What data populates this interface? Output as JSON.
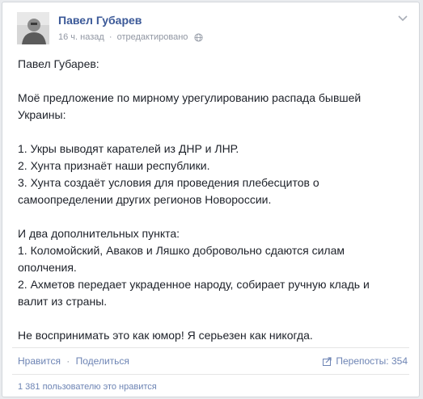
{
  "post": {
    "author": "Павел Губарев",
    "time": "16 ч. назад",
    "edited": "отредактировано",
    "body_lines": [
      "Павел Губарев:",
      "",
      "Моё предложение по мирному урегулированию распада бывшей",
      "Украины:",
      "",
      "1. Укры выводят карателей из ДНР и ЛНР.",
      "2. Хунта признаёт наши республики.",
      "3. Хунта создаёт условия для проведения плебесцитов о",
      "самоопределении других регионов Новороссии.",
      "",
      "И два дополнительных пункта:",
      "1. Коломойский, Аваков и Ляшко добровольно сдаются силам",
      "ополчения.",
      "2. Ахметов передает украденное народу, собирает ручную кладь и",
      "валит из страны.",
      "",
      "Не воспринимать это как юмор! Я серьезен как никогда."
    ]
  },
  "actions": {
    "like": "Нравится",
    "separator": "·",
    "share": "Поделиться",
    "shares_label": "Перепосты: 354"
  },
  "likes": {
    "text": "1 381 пользователю это нравится"
  },
  "icons": {
    "meta_separator": "·",
    "avatar": "avatar-photo",
    "globe": "globe-icon",
    "chevron": "chevron-down-icon",
    "share": "share-icon"
  },
  "colors": {
    "link": "#3b5998",
    "muted": "#9197a3",
    "text": "#1d2129"
  }
}
